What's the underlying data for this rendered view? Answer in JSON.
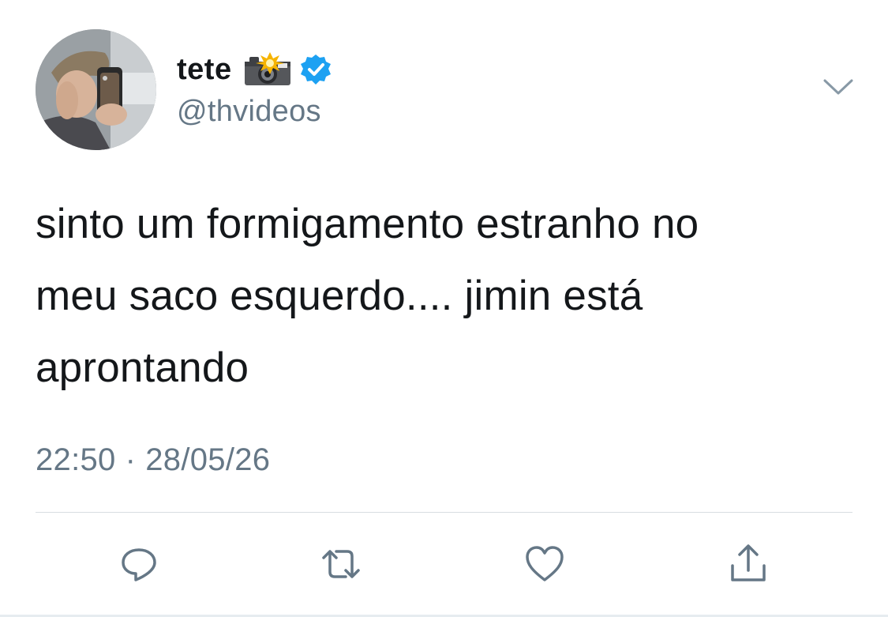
{
  "author": {
    "display_name": "tete",
    "name_emoji_icon": "camera-with-flash-icon",
    "verified_icon": "verified-badge-icon",
    "handle": "@thvideos",
    "avatar_icon": "profile-photo",
    "verified_color": "#1da1f2"
  },
  "menu": {
    "caret_icon": "chevron-down-icon"
  },
  "tweet": {
    "lines": [
      "sinto um formigamento estranho no",
      "meu saco esquerdo.... jimin está",
      "apronta ndo"
    ],
    "time": "22:50",
    "separator": "·",
    "date": "28/05/26"
  },
  "actions": {
    "reply_icon": "reply-icon",
    "retweet_icon": "retweet-icon",
    "like_icon": "heart-icon",
    "share_icon": "share-icon",
    "icon_color": "#657786"
  },
  "colors": {
    "text": "#14171a",
    "secondary": "#657786",
    "divider": "#d8dde1"
  }
}
